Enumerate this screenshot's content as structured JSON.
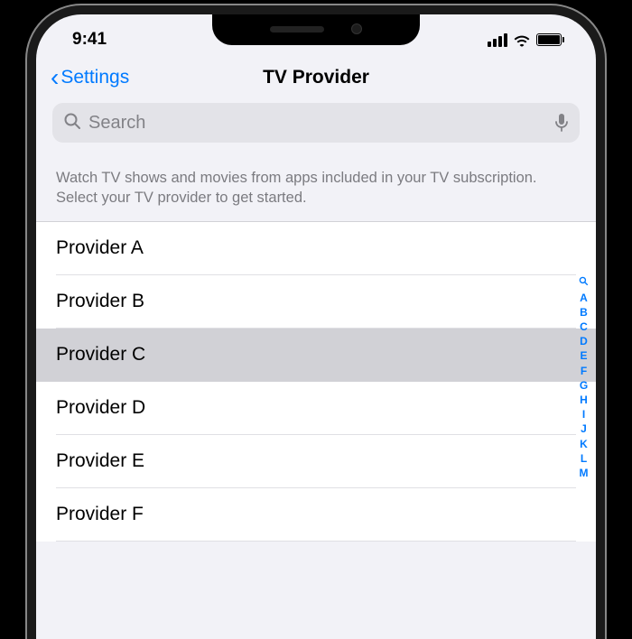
{
  "status": {
    "time": "9:41"
  },
  "nav": {
    "back": "Settings",
    "title": "TV Provider"
  },
  "search": {
    "placeholder": "Search",
    "value": ""
  },
  "description": "Watch TV shows and movies from apps included in your TV subscription. Select your TV provider to get started.",
  "providers": [
    {
      "name": "Provider A",
      "selected": false
    },
    {
      "name": "Provider B",
      "selected": false
    },
    {
      "name": "Provider C",
      "selected": true
    },
    {
      "name": "Provider D",
      "selected": false
    },
    {
      "name": "Provider E",
      "selected": false
    },
    {
      "name": "Provider F",
      "selected": false
    }
  ],
  "index": [
    "A",
    "B",
    "C",
    "D",
    "E",
    "F",
    "G",
    "H",
    "I",
    "J",
    "K",
    "L",
    "M"
  ],
  "colors": {
    "accent": "#007aff",
    "bg": "#f2f2f7",
    "search_bg": "#e3e3e8",
    "muted": "#828287"
  }
}
